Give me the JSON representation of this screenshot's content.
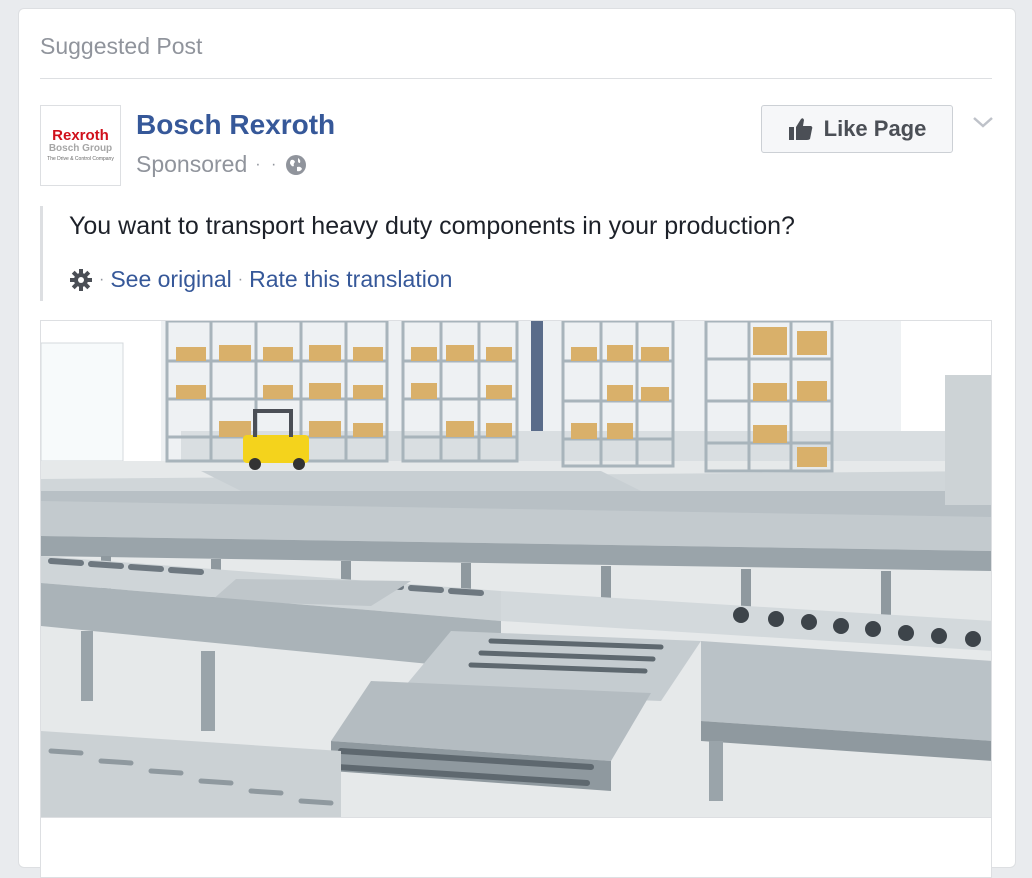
{
  "post": {
    "header_label": "Suggested Post",
    "page_name": "Bosch Rexroth",
    "sponsored_label": "Sponsored",
    "meta_dots": "· ·",
    "like_button_label": "Like Page",
    "text": "You want to transport heavy duty components in your production?",
    "translation": {
      "see_original": "See original",
      "separator": "·",
      "rate_translation": "Rate this translation"
    }
  },
  "logo": {
    "brand": "Rexroth",
    "group": "Bosch Group",
    "tagline": "The Drive & Control Company"
  },
  "icons": {
    "globe": "globe-icon",
    "thumbs_up": "thumbs-up-icon",
    "chevron": "chevron-down-icon",
    "gear": "gear-icon"
  },
  "colors": {
    "link": "#365899",
    "muted": "#90949c",
    "brand_red": "#d0101b"
  }
}
